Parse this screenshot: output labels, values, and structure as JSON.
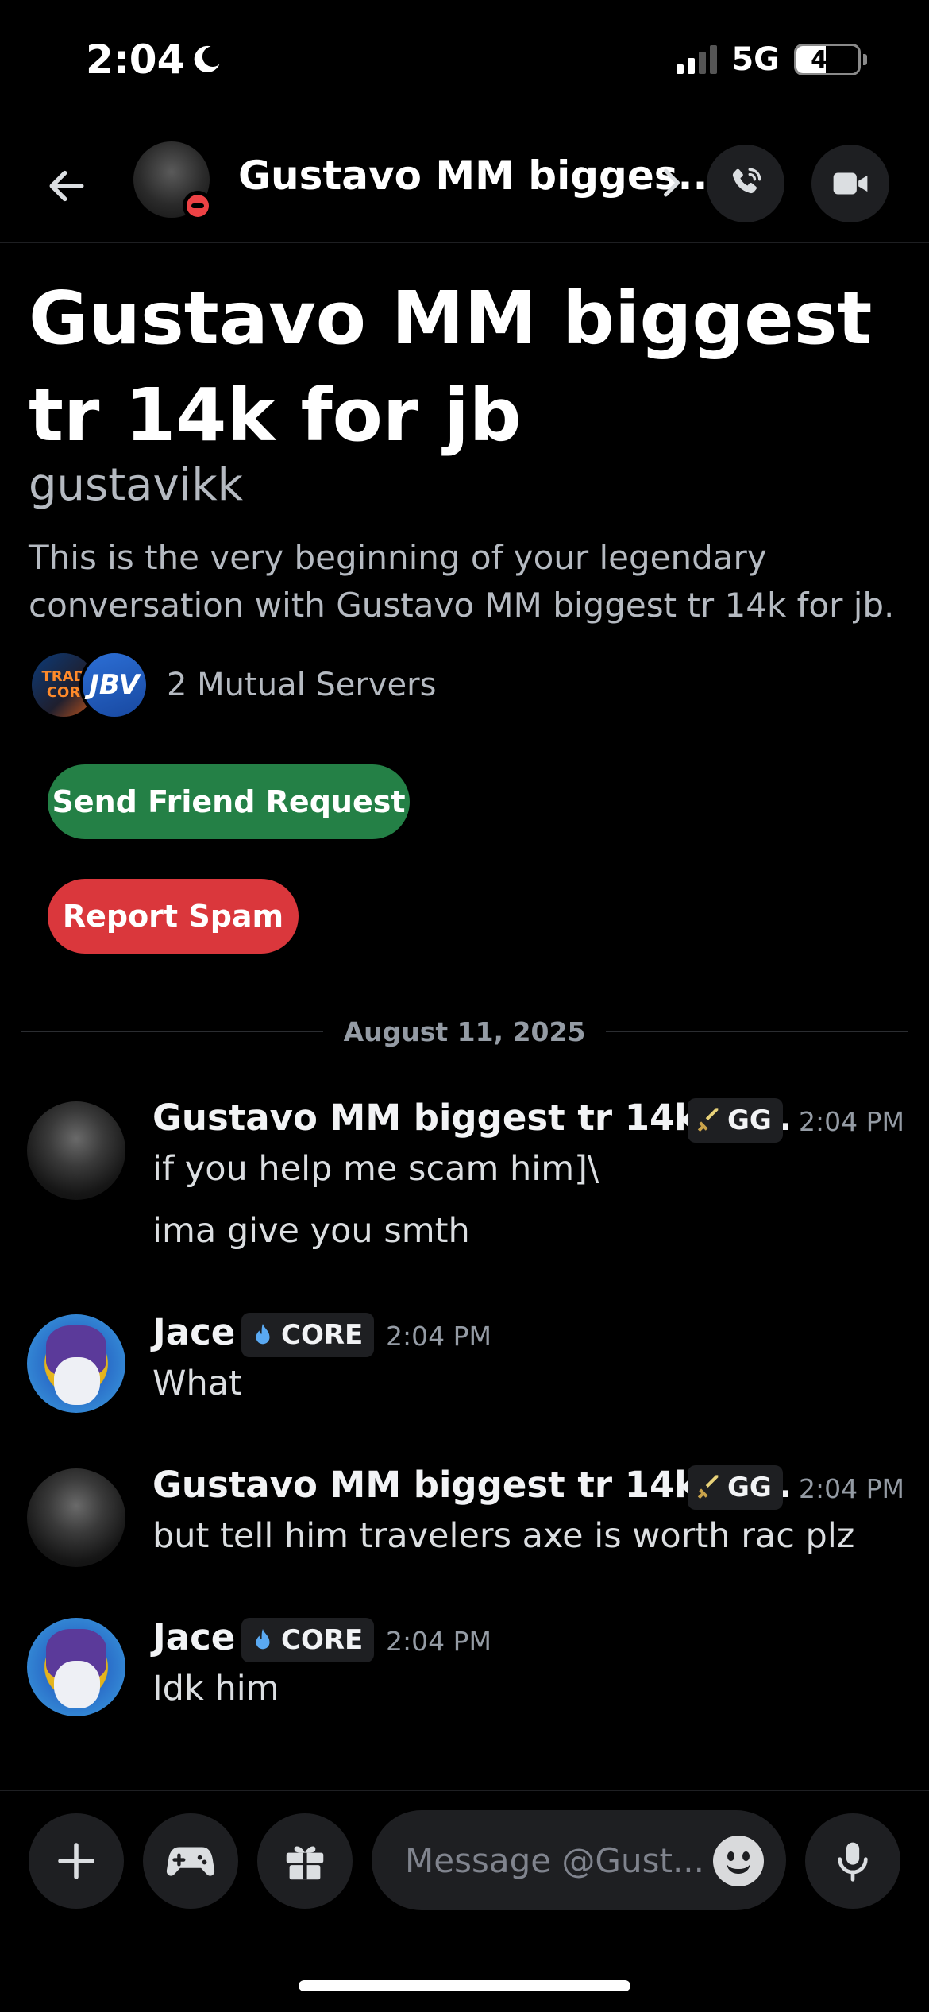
{
  "status_bar": {
    "time": "2:04",
    "network": "5G",
    "battery": "47",
    "battery_level": 0.47
  },
  "header": {
    "title": "Gustavo MM bigges...",
    "status": "do-not-disturb"
  },
  "profile": {
    "display_name": "Gustavo MM biggest tr 14k for jb",
    "username": "gustavikk",
    "intro": "This is the very beginning of your legendary conversation with Gustavo MM biggest tr 14k for jb.",
    "mutual_servers": "2 Mutual Servers",
    "server_icons": [
      "TRAD COR",
      "JBV"
    ]
  },
  "actions": {
    "friend_request": "Send Friend Request",
    "report_spam": "Report Spam"
  },
  "date_divider": "August 11, 2025",
  "messages": [
    {
      "author": "Gustavo MM biggest tr 14k fo...",
      "tag": "GG",
      "tag_icon": "sword-icon",
      "time": "2:04 PM",
      "lines": [
        "if you help me scam him]\\",
        "ima give you smth"
      ]
    },
    {
      "author": "Jace",
      "tag": "CORE",
      "tag_icon": "flame-icon",
      "time": "2:04 PM",
      "lines": [
        "What"
      ]
    },
    {
      "author": "Gustavo MM biggest tr 14k fo...",
      "tag": "GG",
      "tag_icon": "sword-icon",
      "time": "2:04 PM",
      "lines": [
        "but tell him travelers axe is worth rac plz"
      ]
    },
    {
      "author": "Jace",
      "tag": "CORE",
      "tag_icon": "flame-icon",
      "time": "2:04 PM",
      "lines": [
        "Idk him"
      ]
    }
  ],
  "composer": {
    "placeholder": "Message @Gust..."
  },
  "colors": {
    "background": "#000000",
    "friend_button": "#248046",
    "spam_button": "#da373c",
    "dnd": "#ed4245",
    "muted_text": "#b5bac1"
  }
}
